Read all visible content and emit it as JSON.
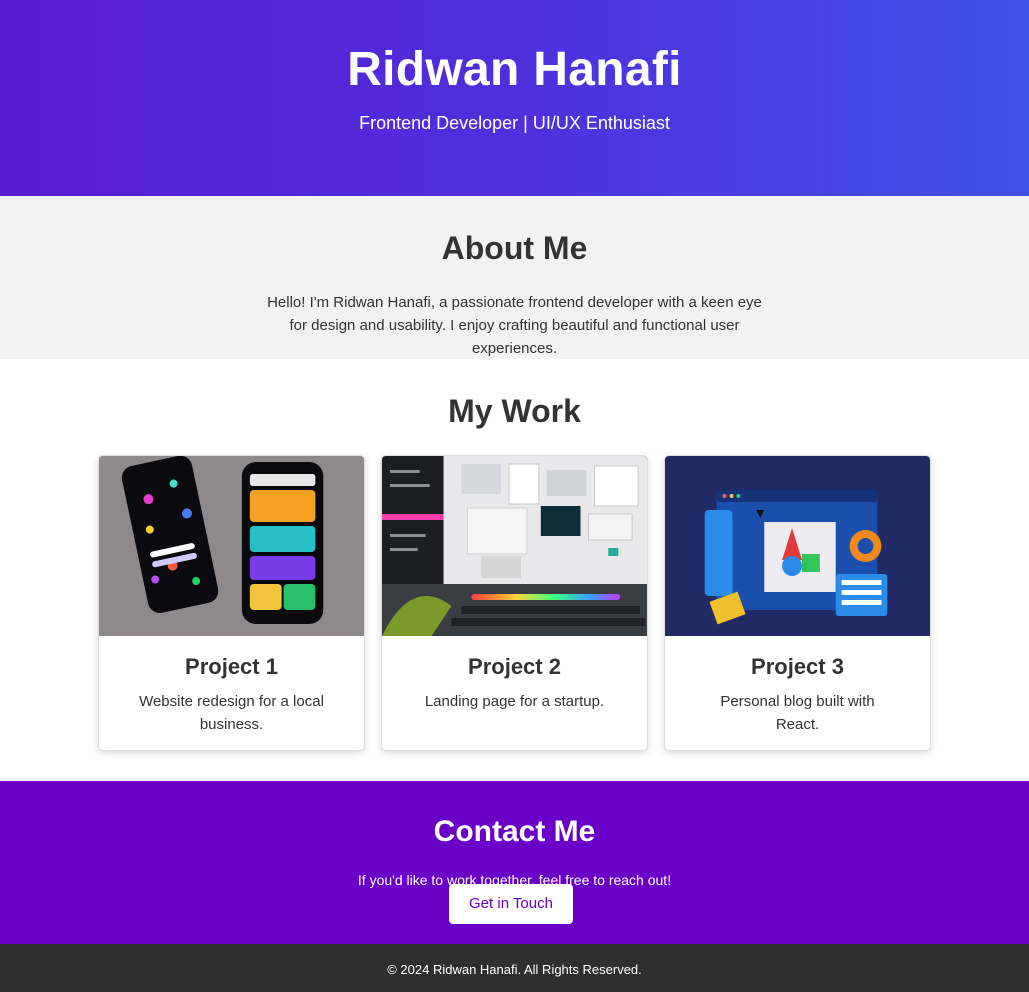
{
  "hero": {
    "title": "Ridwan Hanafi",
    "subtitle": "Frontend Developer | UI/UX Enthusiast"
  },
  "about": {
    "heading": "About Me",
    "text": "Hello! I'm Ridwan Hanafi, a passionate frontend developer with a keen eye for design and usability. I enjoy crafting beautiful and functional user experiences."
  },
  "work": {
    "heading": "My Work",
    "projects": [
      {
        "title": "Project 1",
        "description": "Website redesign for a local business."
      },
      {
        "title": "Project 2",
        "description": "Landing page for a startup."
      },
      {
        "title": "Project 3",
        "description": "Personal blog built with React."
      }
    ]
  },
  "contact": {
    "heading": "Contact Me",
    "text": "If you'd like to work together, feel free to reach out!",
    "button_label": "Get in Touch"
  },
  "footer": {
    "text": "© 2024 Ridwan Hanafi. All Rights Reserved."
  },
  "colors": {
    "hero_gradient_start": "#5a1bd1",
    "hero_gradient_end": "#3f52e7",
    "contact_bg": "#6a00c8",
    "about_bg": "#f2f2f2",
    "footer_bg": "#2f2f2f",
    "text_dark": "#333333"
  }
}
